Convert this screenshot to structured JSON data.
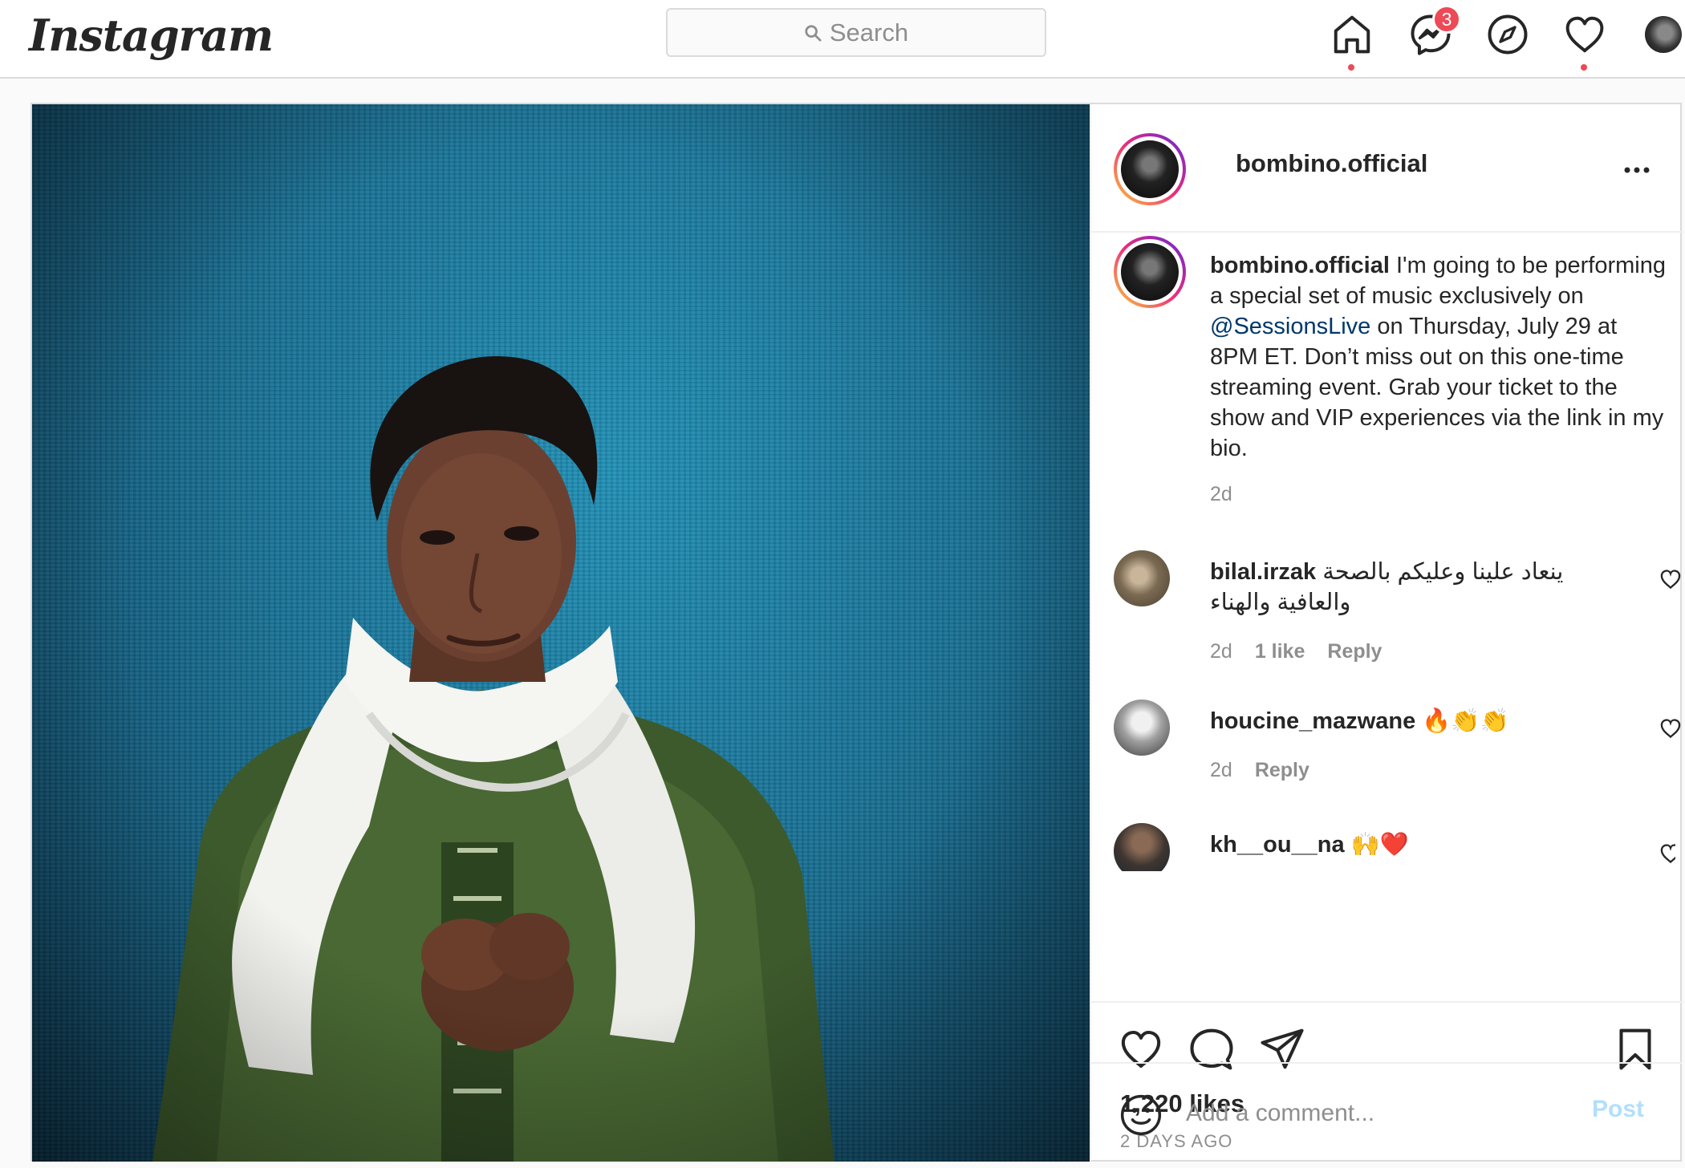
{
  "app": {
    "logo": "Instagram",
    "search": {
      "placeholder": "Search"
    },
    "nav": {
      "messages_badge": "3"
    }
  },
  "post": {
    "author": "bombino.official",
    "caption": {
      "username": "bombino.official",
      "text_before": " I'm going to be performing a special set of music exclusively on ",
      "mention": "@SessionsLive",
      "text_after": " on Thursday, July 29 at 8PM ET. Don’t miss out on this one-time streaming event. Grab your ticket to the show and VIP experiences via the link in my bio.",
      "time": "2d"
    },
    "comments": [
      {
        "username": "bilal.irzak",
        "text": " ينعاد علينا وعليكم بالصحة والعافية والهناء",
        "time": "2d",
        "likes": "1 like",
        "reply": "Reply"
      },
      {
        "username": "houcine_mazwane",
        "text": " 🔥👏👏",
        "time": "2d",
        "reply": "Reply"
      },
      {
        "username": "kh__ou__na",
        "text": " 🙌❤️"
      }
    ],
    "likes": "1,220 likes",
    "date": "2 DAYS AGO",
    "add_comment": {
      "placeholder": "Add a comment...",
      "post_label": "Post"
    }
  },
  "colors": {
    "accent_blue": "#0095f6",
    "post_disabled": "#b2dffc",
    "notification_red": "#ed4956",
    "mention": "#00376b"
  },
  "icons": [
    "search-icon",
    "home-icon",
    "messenger-icon",
    "explore-icon",
    "activity-heart-icon",
    "more-icon",
    "heart-icon",
    "comment-icon",
    "share-icon",
    "bookmark-icon",
    "emoji-icon"
  ]
}
